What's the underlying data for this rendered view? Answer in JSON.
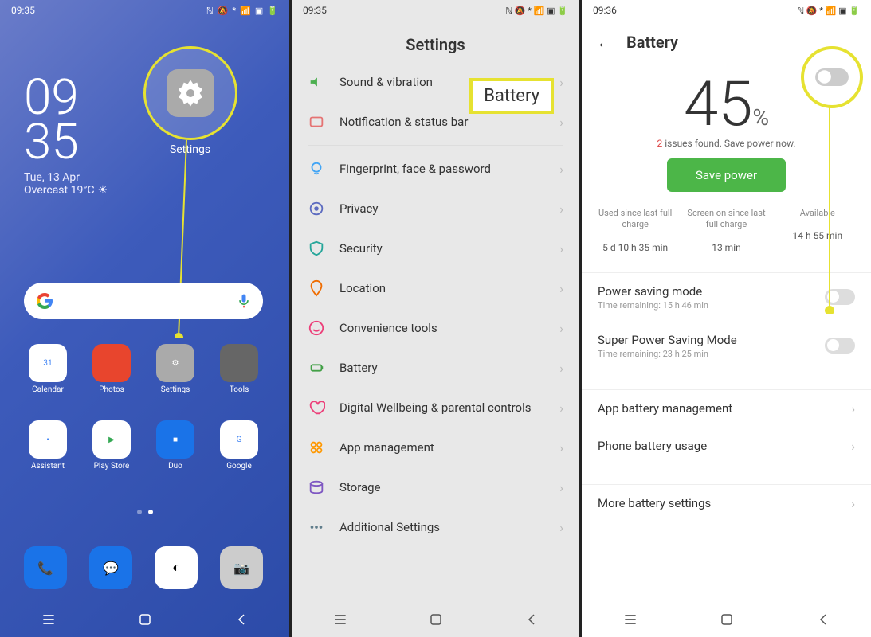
{
  "panel1": {
    "time": "09:35",
    "clock_h": "09",
    "clock_m": "35",
    "date": "Tue, 13 Apr",
    "weather": "Overcast 19°C",
    "callout_label": "Settings",
    "apps_row1": [
      {
        "label": "Calendar",
        "bg": "#fff",
        "txt": "31",
        "fg": "#4285f4"
      },
      {
        "label": "Photos",
        "bg": "#e8452d",
        "txt": "",
        "fg": "#fff"
      },
      {
        "label": "Settings",
        "bg": "#aaa",
        "txt": "⚙",
        "fg": "#fff"
      },
      {
        "label": "Tools",
        "bg": "#666",
        "txt": "",
        "fg": "#fff"
      }
    ],
    "apps_row2": [
      {
        "label": "Assistant",
        "bg": "#fff",
        "txt": "•",
        "fg": "#4285f4"
      },
      {
        "label": "Play Store",
        "bg": "#fff",
        "txt": "▶",
        "fg": "#34a853"
      },
      {
        "label": "Duo",
        "bg": "#1a73e8",
        "txt": "■",
        "fg": "#fff"
      },
      {
        "label": "Google",
        "bg": "#fff",
        "txt": "G",
        "fg": "#4285f4"
      }
    ],
    "dock": [
      {
        "bg": "#1a73e8",
        "txt": "📞",
        "name": "phone-icon"
      },
      {
        "bg": "#1a73e8",
        "txt": "💬",
        "name": "messages-icon"
      },
      {
        "bg": "#fff",
        "txt": "◐",
        "name": "chrome-icon"
      },
      {
        "bg": "#ccc",
        "txt": "📷",
        "name": "camera-icon"
      }
    ]
  },
  "panel2": {
    "time": "09:35",
    "title": "Settings",
    "callout": "Battery",
    "items": [
      {
        "icon": "sound",
        "label": "Sound & vibration"
      },
      {
        "icon": "notify",
        "label": "Notification & status bar"
      },
      {
        "divider": true
      },
      {
        "icon": "finger",
        "label": "Fingerprint, face & password"
      },
      {
        "icon": "privacy",
        "label": "Privacy"
      },
      {
        "icon": "security",
        "label": "Security"
      },
      {
        "icon": "location",
        "label": "Location"
      },
      {
        "icon": "smile",
        "label": "Convenience tools"
      },
      {
        "icon": "battery",
        "label": "Battery"
      },
      {
        "icon": "heart",
        "label": "Digital Wellbeing & parental controls"
      },
      {
        "icon": "apps",
        "label": "App management"
      },
      {
        "icon": "storage",
        "label": "Storage"
      },
      {
        "icon": "additional",
        "label": "Additional Settings"
      }
    ]
  },
  "panel3": {
    "time": "09:36",
    "title": "Battery",
    "percent": "45",
    "percent_sym": "%",
    "issues_n": "2",
    "issues_txt": " issues found. Save power now.",
    "save_btn": "Save power",
    "stats": [
      {
        "label": "Used since last full charge",
        "value": "5 d 10 h 35 min"
      },
      {
        "label": "Screen on since last full charge",
        "value": "13 min"
      },
      {
        "label": "Available",
        "value": "14 h 55 min"
      }
    ],
    "modes": [
      {
        "title": "Power saving mode",
        "sub": "Time remaining:  15 h 46 min"
      },
      {
        "title": "Super Power Saving Mode",
        "sub": "Time remaining:  23 h 25 min"
      }
    ],
    "links": [
      "App battery management",
      "Phone battery usage",
      "More battery settings"
    ]
  }
}
